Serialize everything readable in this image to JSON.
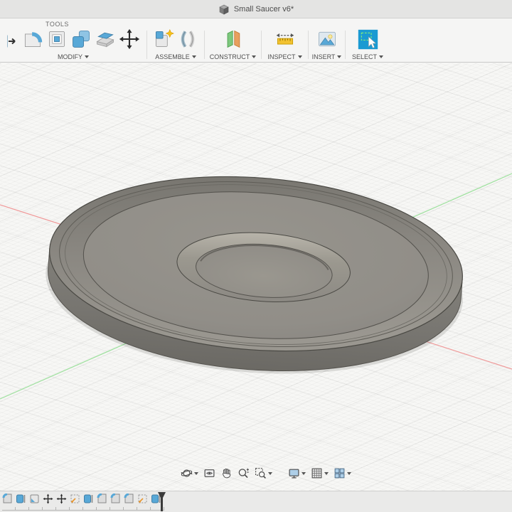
{
  "app": {
    "title": "Small Saucer v6*",
    "window_icon": "cube-icon"
  },
  "colors": {
    "accent_blue": "#1a9ad2",
    "icon_blue": "#58a8d7",
    "axis_red": "#ef9a9a",
    "axis_green": "#9ce09c",
    "saucer_gray": "#8e8b84",
    "toolbar_bg": "#f5f5f4",
    "viewport_bg": "#f7f7f5"
  },
  "toolbar": {
    "tab": "TOOLS",
    "groups": [
      {
        "label": "MODIFY",
        "icons": [
          "press-pull-icon",
          "fillet-icon",
          "shell-icon",
          "combine-icon",
          "offset-face-icon",
          "move-icon"
        ]
      },
      {
        "label": "ASSEMBLE",
        "icons": [
          "new-component-icon",
          "joint-icon"
        ]
      },
      {
        "label": "CONSTRUCT",
        "icons": [
          "construct-plane-icon"
        ]
      },
      {
        "label": "INSPECT",
        "icons": [
          "measure-icon"
        ]
      },
      {
        "label": "INSERT",
        "icons": [
          "canvas-icon"
        ]
      },
      {
        "label": "SELECT",
        "icons": [
          "select-icon"
        ]
      }
    ]
  },
  "viewport": {
    "model": "small saucer 3d body",
    "axes_visible": [
      "x-axis-red",
      "z-axis-green"
    ]
  },
  "nav_toolbar": {
    "items": [
      {
        "name": "orbit",
        "dropdown": true
      },
      {
        "name": "look-at",
        "dropdown": false
      },
      {
        "name": "pan",
        "dropdown": false
      },
      {
        "name": "zoom",
        "dropdown": false
      },
      {
        "name": "fit",
        "dropdown": true
      },
      {
        "name": "display-settings",
        "dropdown": true
      },
      {
        "name": "grid-and-snaps",
        "dropdown": true
      },
      {
        "name": "viewports",
        "dropdown": true
      }
    ]
  },
  "timeline": {
    "operations": [
      "fillet",
      "extrude",
      "form",
      "move",
      "move",
      "sketch",
      "extrude",
      "fillet",
      "fillet",
      "fillet",
      "sketch",
      "extrude"
    ],
    "playhead_after_index": 11
  }
}
